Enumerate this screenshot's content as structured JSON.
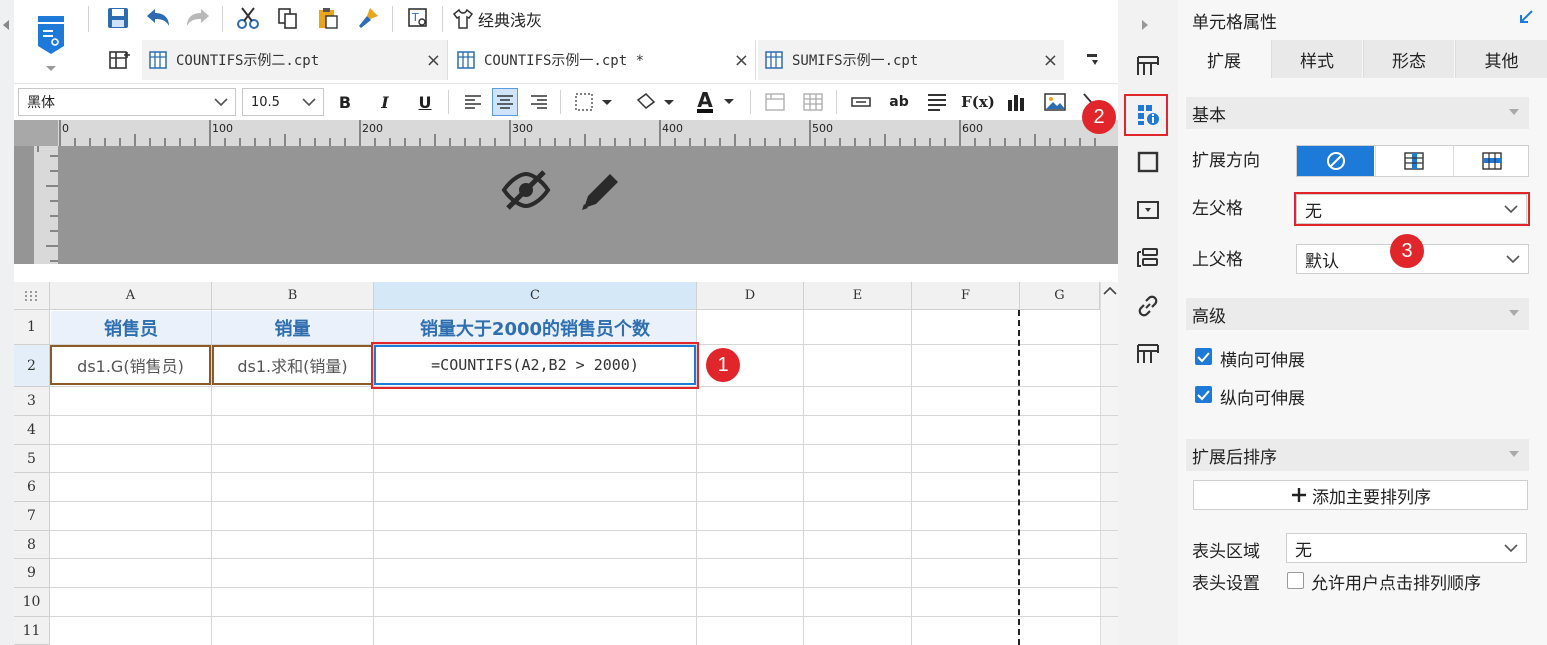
{
  "toolbar": {
    "classic_gray_label": "经典浅灰"
  },
  "tabs": [
    {
      "label": "COUNTIFS示例二.cpt",
      "close": "×"
    },
    {
      "label": "COUNTIFS示例一.cpt *",
      "close": "×"
    },
    {
      "label": "SUMIFS示例一.cpt",
      "close": "×"
    }
  ],
  "format_bar": {
    "font_family": "黑体",
    "font_size": "10.5",
    "bold": "B",
    "italic": "I",
    "underline": "U",
    "text_button": "ab",
    "formula_button": "F(x)",
    "font_color_letter": "A"
  },
  "ruler": {
    "ticks": [
      "0",
      "100",
      "200",
      "300",
      "400",
      "500",
      "600"
    ]
  },
  "grid": {
    "columns": [
      "A",
      "B",
      "C",
      "D",
      "E",
      "F",
      "G"
    ],
    "rows": [
      "1",
      "2",
      "3",
      "4",
      "5",
      "6",
      "7",
      "8",
      "9",
      "10",
      "11"
    ],
    "header_row": [
      "销售员",
      "销量",
      "销量大于2000的销售员个数"
    ],
    "data_row": [
      "ds1.G(销售员)",
      "ds1.求和(销量)",
      "=COUNTIFS(A2,B2 > 2000)"
    ]
  },
  "panel": {
    "title": "单元格属性",
    "tabs": [
      "扩展",
      "样式",
      "形态",
      "其他"
    ],
    "basic_section": "基本",
    "expand_direction_label": "扩展方向",
    "left_parent_label": "左父格",
    "left_parent_value": "无",
    "top_parent_label": "上父格",
    "top_parent_value": "默认",
    "advanced_section": "高级",
    "horizontal_stretch": "横向可伸展",
    "vertical_stretch": "纵向可伸展",
    "sort_section": "扩展后排序",
    "add_sort_button": "添加主要排列序",
    "header_area_label": "表头区域",
    "header_area_value": "无",
    "header_setting_label": "表头设置",
    "allow_user_sort": "允许用户点击排列顺序"
  },
  "badges": [
    "1",
    "2",
    "3"
  ],
  "colors": {
    "accent_blue": "#1e7ad8",
    "header_text_blue": "#2f6fb0",
    "annotation_red": "#e0262a"
  }
}
